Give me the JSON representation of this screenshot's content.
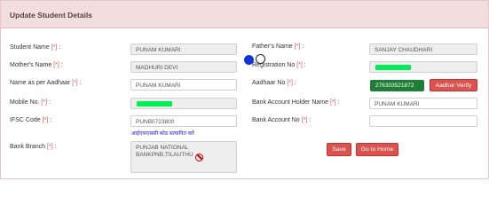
{
  "header": {
    "title": "Update Student Details"
  },
  "form": {
    "student_name": {
      "label": "Student Name",
      "req": "[*]",
      "colon": ":",
      "value": "PUNAM KUMARI"
    },
    "fathers_name": {
      "label": "Father's Name",
      "req": "[*]",
      "colon": ":",
      "value": "SANJAY CHAUDHARI"
    },
    "mothers_name": {
      "label": "Mother's Name",
      "req": "[*]",
      "colon": ":",
      "value": "MADHURI DEVI"
    },
    "registration_no": {
      "label": "Registration No",
      "req": "[*]",
      "colon": ":"
    },
    "name_aadhaar": {
      "label": "Name as per Aadhaar",
      "req": "[*]",
      "colon": ":",
      "value": "PUNAM KUMARI"
    },
    "aadhaar_no": {
      "label": "Aadhaar No",
      "req": "[*]",
      "colon": ":",
      "value": "276303521872"
    },
    "mobile_no": {
      "label": "Mobile No.",
      "req": "[*]",
      "colon": ":"
    },
    "account_holder": {
      "label": "Bank Account Holder Name",
      "req": "[*]",
      "colon": ":",
      "value": "PUNAM KUMARI"
    },
    "ifsc": {
      "label": "IFSC Code",
      "req": "[*]",
      "colon": ":",
      "value": "PUNB0723800"
    },
    "ifsc_hint": "आईएफएससी कोड सत्यापित करें",
    "account_no": {
      "label": "Bank Account No",
      "req": "[*]",
      "colon": ":",
      "value": ""
    },
    "bank_branch": {
      "label": "Bank Branch",
      "req": "[*]",
      "colon": ":",
      "value": "PUNJAB NATIONAL BANKPNB,TILAUTHU"
    }
  },
  "buttons": {
    "aadhaar_verify": "Aadhar Verify",
    "save": "Save",
    "home": "Go to Home"
  },
  "colors": {
    "header_bg": "#f2dede",
    "button_red": "#d9534f",
    "aadhaar_green": "#1e7e34",
    "mask_green": "#00ee55"
  }
}
